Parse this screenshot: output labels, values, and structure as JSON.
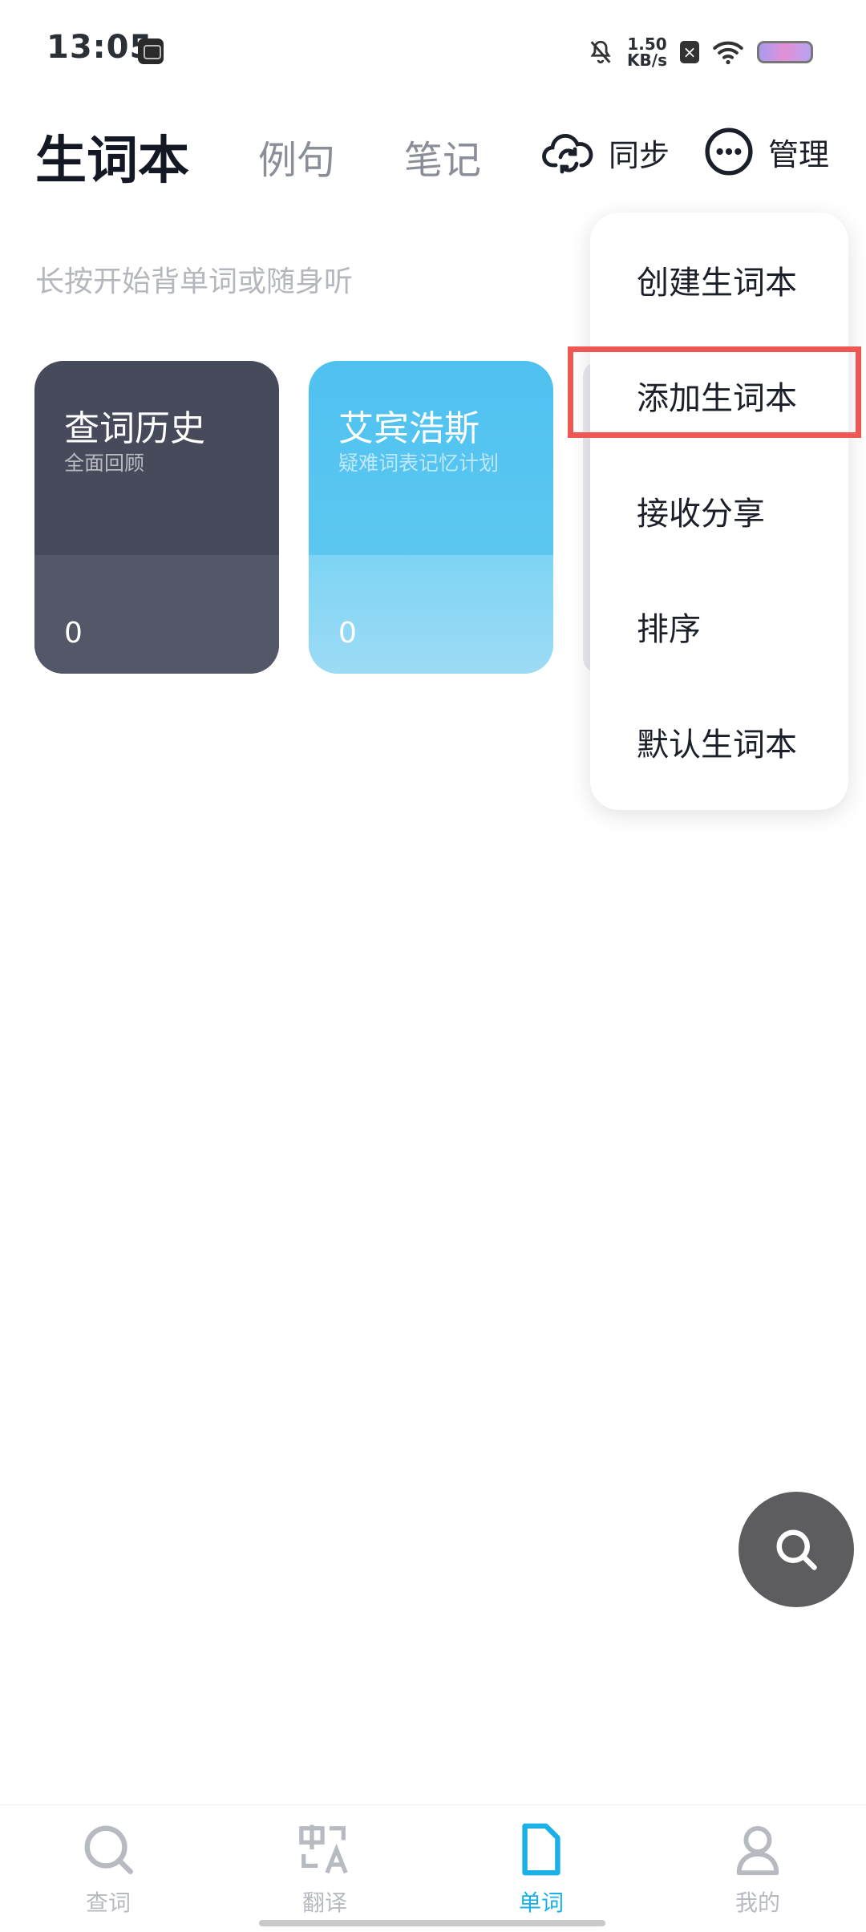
{
  "status_bar": {
    "time": "13:05",
    "network_speed_value": "1.50",
    "network_speed_unit": "KB/s",
    "icons": [
      "app-badge-icon",
      "bell-muted-icon",
      "x-badge-icon",
      "wifi-icon",
      "battery-icon"
    ]
  },
  "header": {
    "tabs": [
      {
        "label": "生词本",
        "active": true
      },
      {
        "label": "例句",
        "active": false
      },
      {
        "label": "笔记",
        "active": false
      }
    ],
    "sync_label": "同步",
    "manage_label": "管理"
  },
  "hint": "长按开始背单词或随身听",
  "cards": [
    {
      "title": "查词历史",
      "subtitle": "全面回顾",
      "count": "0"
    },
    {
      "title": "艾宾浩斯",
      "subtitle": "疑难词表记忆计划",
      "count": "0"
    }
  ],
  "menu": {
    "items": [
      "创建生词本",
      "添加生词本",
      "接收分享",
      "排序",
      "默认生词本"
    ],
    "highlighted_index": 1,
    "highlight_color": "#ef5753"
  },
  "bottom_nav": {
    "items": [
      {
        "label": "查词",
        "icon": "search-icon",
        "active": false
      },
      {
        "label": "翻译",
        "icon": "translate-icon",
        "active": false
      },
      {
        "label": "单词",
        "icon": "document-icon",
        "active": true
      },
      {
        "label": "我的",
        "icon": "user-icon",
        "active": false
      }
    ],
    "active_color": "#1ab1e6"
  }
}
